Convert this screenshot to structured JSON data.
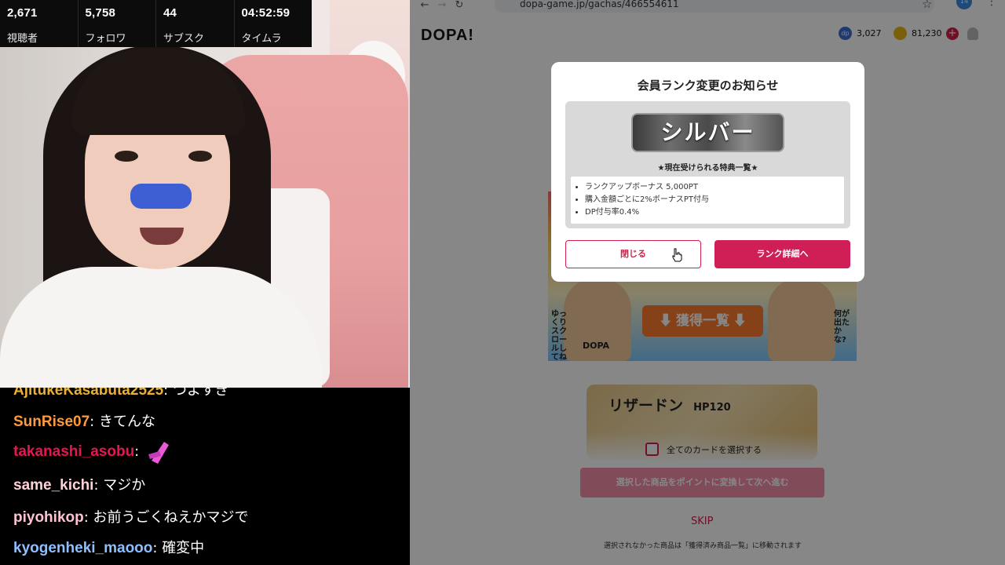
{
  "stream_stats": [
    {
      "value": "2,671",
      "label": "視聴者"
    },
    {
      "value": "5,758",
      "label": "フォロワ"
    },
    {
      "value": "44",
      "label": "サブスク"
    },
    {
      "value": "04:52:59",
      "label": "タイムラ"
    }
  ],
  "chat": [
    {
      "user": "AjitukeKasabuta2525",
      "user_color": "#e9b035",
      "text": "つよすぎ"
    },
    {
      "user": "SunRise07",
      "user_color": "#ff9a3d",
      "text": "きてんな"
    },
    {
      "user": "takanashi_asobu",
      "user_color": "#e8164d",
      "text": ""
    },
    {
      "user": "same_kichi",
      "user_color": "#ffd2d8",
      "text": "マジか"
    },
    {
      "user": "piyohikop",
      "user_color": "#ffc3d2",
      "text": "お前うごくねえかマジで"
    },
    {
      "user": "kyogenheki_maooo",
      "user_color": "#8fbfff",
      "text": "確変中"
    }
  ],
  "browser": {
    "url": "dopa-game.jp/gachas/466554611",
    "profile_badge": "14"
  },
  "site": {
    "logo": "DOPA!",
    "dp_icon": "dp",
    "dp_points": "3,027",
    "coin_points": "81,230",
    "plus_label": "+"
  },
  "background": {
    "banner_button": "⬇ 獲得一覧 ⬇",
    "banner_left_text": "ゆっくりスクロールしてね",
    "banner_right_text": "何が出たかな?",
    "banner_tag": "DOPA",
    "card_name": "リザードン",
    "card_hp": "HP120",
    "select_all": "全てのカードを選択する",
    "convert_button": "選択した商品をポイントに変換して次へ進む",
    "skip": "SKIP",
    "note": "選択されなかった商品は「獲得済み商品一覧」に移動されます"
  },
  "modal": {
    "title": "会員ランク変更のお知らせ",
    "rank": "シルバー",
    "perks_heading": "★現在受けられる特典一覧★",
    "perks": [
      "ランクアップボーナス 5,000PT",
      "購入金額ごとに2%ボーナスPT付与",
      "DP付与率0.4%"
    ],
    "close_button": "閉じる",
    "rank_detail_button": "ランク詳細へ"
  },
  "colors": {
    "accent": "#d01e57",
    "overlay": "rgba(0,0,0,0.47)"
  }
}
